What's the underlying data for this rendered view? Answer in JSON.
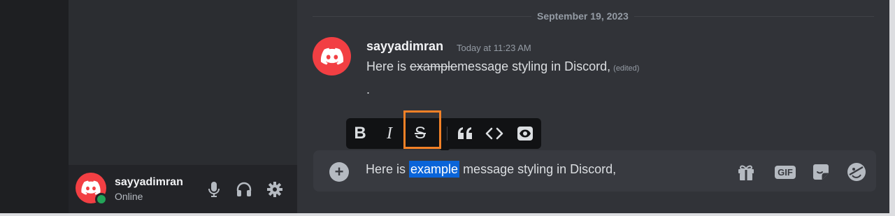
{
  "user_panel": {
    "username": "sayyadimran",
    "status": "Online",
    "mic_icon": "microphone-icon",
    "headset_icon": "headphones-icon",
    "settings_icon": "gear-icon"
  },
  "chat": {
    "date_divider": "September 19, 2023",
    "message": {
      "author": "sayyadimran",
      "timestamp": "Today at 11:23 AM",
      "text_prefix": "Here is ",
      "text_strike": "example",
      "text_suffix": "message styling in Discord,",
      "edited": "(edited)",
      "second_line": "."
    }
  },
  "format_toolbar": {
    "bold_label": "B",
    "italic_label": "I",
    "strike_label": "S",
    "quote_icon": "quote-icon",
    "code_icon": "code-icon",
    "spoiler_icon": "eye-icon",
    "highlighted": "strikethrough",
    "highlight_color": "#f38127"
  },
  "composer": {
    "text_before": "Here is ",
    "text_selected": "example",
    "text_after": " message styling in Discord,",
    "gif_label": "GIF",
    "icons": [
      "gift-icon",
      "gif-icon",
      "sticker-icon",
      "emoji-icon"
    ]
  },
  "colors": {
    "brand_red": "#f23f43",
    "online_green": "#23a559",
    "selection_blue": "#0a64d8"
  }
}
